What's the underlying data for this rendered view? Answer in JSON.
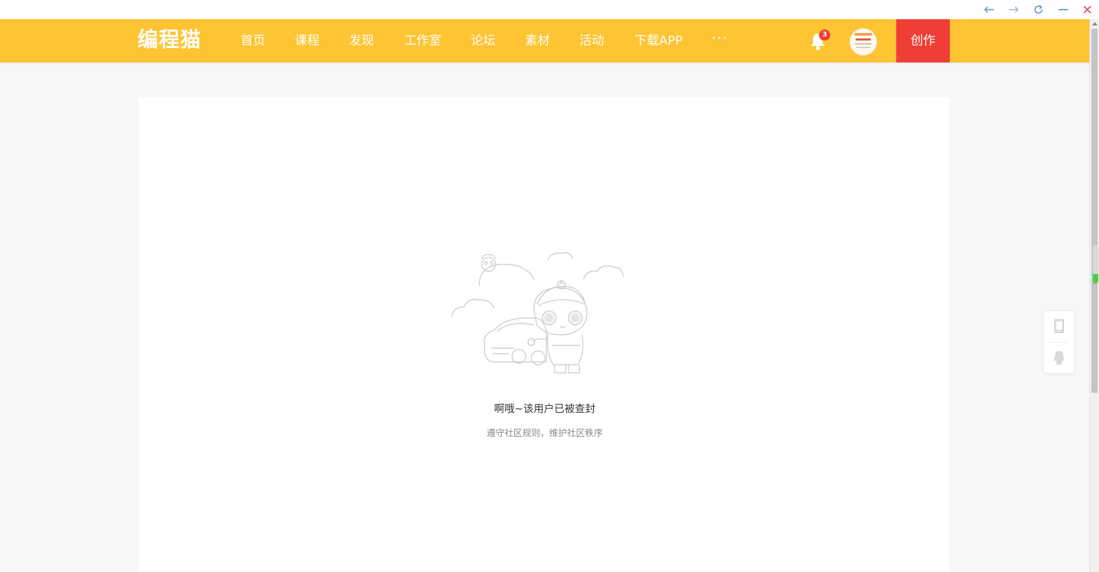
{
  "window": {
    "controls": [
      "back-icon",
      "forward-icon",
      "refresh-icon",
      "minimize-icon",
      "close-icon"
    ]
  },
  "nav": {
    "logo": "编程猫",
    "items": [
      {
        "label": "首页"
      },
      {
        "label": "课程"
      },
      {
        "label": "发现"
      },
      {
        "label": "工作室"
      },
      {
        "label": "论坛"
      },
      {
        "label": "素材"
      },
      {
        "label": "活动"
      },
      {
        "label": "下载APP"
      }
    ],
    "more": "···",
    "notification_count": "3",
    "create_label": "创作"
  },
  "empty_state": {
    "title": "啊哦~该用户已被查封",
    "subtitle": "遵守社区规则，维护社区秩序"
  },
  "side_panel": {
    "icons": [
      "phone-icon",
      "qq-penguin-icon"
    ]
  },
  "colors": {
    "nav_bg": "#fec433",
    "create_bg": "#ef3e36",
    "page_bg": "#f7f7f7",
    "badge": "#ee3b3b"
  }
}
